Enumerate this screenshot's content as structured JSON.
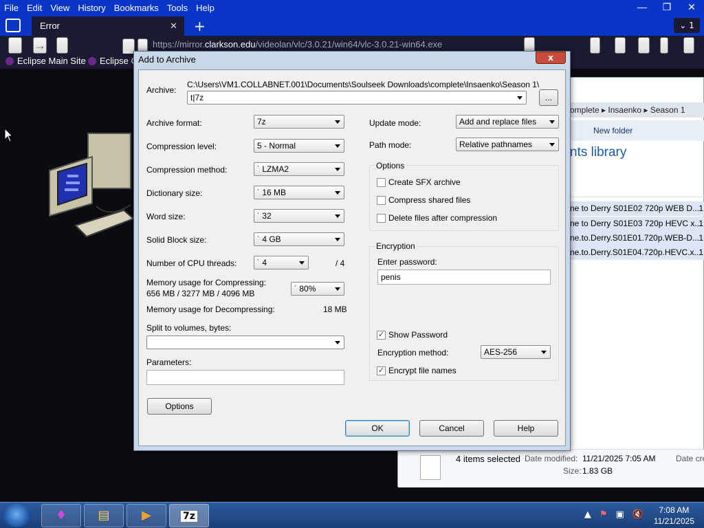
{
  "browser": {
    "menu": [
      "File",
      "Edit",
      "View",
      "History",
      "Bookmarks",
      "Tools",
      "Help"
    ],
    "tab_title": "Error",
    "tab_count": "1",
    "url_prefix": "https://mirror.",
    "url_host": "clarkson.edu",
    "url_path": "/videolan/vlc/3.0.21/win64/vlc-3.0.21-win64.exe",
    "bookmarks": [
      "Eclipse Main Site",
      "Eclipse C"
    ]
  },
  "explorer": {
    "breadcrumb": [
      "omplete",
      "Insaenko",
      "Season 1"
    ],
    "new_folder": "New folder",
    "library_title": "nts library",
    "files": [
      {
        "name": "ne to Derry S01E02 720p WEB D...",
        "col": "1"
      },
      {
        "name": "ne to Derry S01E03 720p HEVC x...",
        "col": "1"
      },
      {
        "name": "ne.to.Derry.S01E01.720p.WEB-D...",
        "col": "1"
      },
      {
        "name": "ne.to.Derry.S01E04.720p.HEVC.x...",
        "col": "1"
      }
    ],
    "status": {
      "selected": "4 items selected",
      "date_modified_label": "Date modified:",
      "date_modified": "11/21/2025 7:05 AM",
      "date_created_label": "Date cre",
      "size_label": "Size:",
      "size": "1.83 GB"
    }
  },
  "dialog": {
    "title": "Add to Archive",
    "close": "x",
    "archive_label": "Archive:",
    "archive_path": "C:\\Users\\VM1.COLLABNET.001\\Documents\\Soulseek Downloads\\complete\\Insaenko\\Season 1\\",
    "archive_name": "t|7z",
    "browse": "...",
    "left": {
      "archive_format": {
        "label": "Archive format:",
        "value": "7z"
      },
      "compression_level": {
        "label": "Compression level:",
        "value": "5 - Normal"
      },
      "compression_method": {
        "label": "Compression method:",
        "value": "LZMA2"
      },
      "dictionary_size": {
        "label": "Dictionary size:",
        "value": "16 MB"
      },
      "word_size": {
        "label": "Word size:",
        "value": "32"
      },
      "solid_block": {
        "label": "Solid Block size:",
        "value": "4 GB"
      },
      "cpu_threads": {
        "label": "Number of CPU threads:",
        "value": "4",
        "max": "/ 4"
      },
      "mem_compress": {
        "label": "Memory usage for Compressing:",
        "detail": "656 MB / 3277 MB / 4096 MB",
        "value": "80%"
      },
      "mem_decompress": {
        "label": "Memory usage for Decompressing:",
        "value": "18 MB"
      },
      "split_label": "Split to volumes, bytes:",
      "split_value": "",
      "parameters_label": "Parameters:",
      "parameters_value": "",
      "options_button": "Options"
    },
    "right": {
      "update_mode": {
        "label": "Update mode:",
        "value": "Add and replace files"
      },
      "path_mode": {
        "label": "Path mode:",
        "value": "Relative pathnames"
      },
      "options_group": "Options",
      "create_sfx": {
        "label": "Create SFX archive",
        "checked": false
      },
      "compress_shared": {
        "label": "Compress shared files",
        "checked": false
      },
      "delete_after": {
        "label": "Delete files after compression",
        "checked": false
      },
      "encryption_group": "Encryption",
      "enter_password_label": "Enter password:",
      "password": "penis",
      "show_password": {
        "label": "Show Password",
        "checked": true
      },
      "encryption_method": {
        "label": "Encryption method:",
        "value": "AES-256"
      },
      "encrypt_names": {
        "label": "Encrypt file names",
        "checked": true
      }
    },
    "buttons": {
      "ok": "OK",
      "cancel": "Cancel",
      "help": "Help"
    }
  },
  "taskbar": {
    "time": "7:08 AM",
    "date": "11/21/2025",
    "active_app_label": "7z"
  }
}
